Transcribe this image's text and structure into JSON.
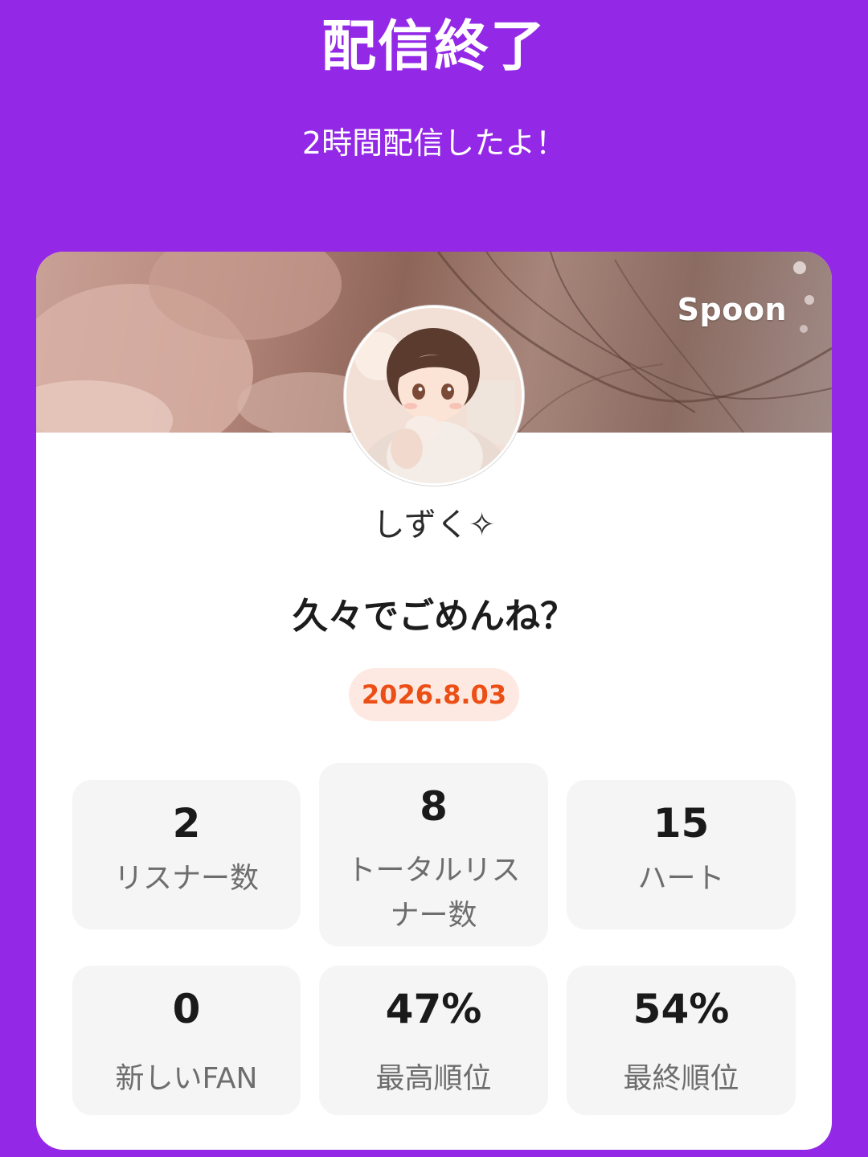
{
  "header": {
    "title": "配信終了",
    "subtitle": "2時間配信したよ！"
  },
  "card": {
    "brand": "Spoon",
    "username": "しずく✧",
    "live_title": "久々でごめんね？",
    "date": "2026.8.03"
  },
  "stats": [
    {
      "value": "2",
      "label": "リスナー数"
    },
    {
      "value": "8",
      "label": "トータルリス ナー数"
    },
    {
      "value": "15",
      "label": "ハート"
    },
    {
      "value": "0",
      "label": "新しいFAN"
    },
    {
      "value": "47%",
      "label": "最高順位"
    },
    {
      "value": "54%",
      "label": "最終順位"
    }
  ],
  "colors": {
    "background": "#9328e6",
    "date_text": "#ec4f16",
    "date_badge": "#fde9e1"
  }
}
